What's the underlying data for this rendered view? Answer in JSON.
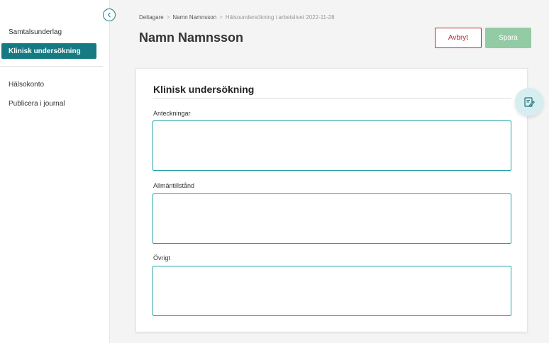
{
  "sidebar": {
    "items": [
      {
        "label": "Samtalsunderlag"
      },
      {
        "label": "Klinisk undersökning"
      },
      {
        "label": "Hälsokonto"
      },
      {
        "label": "Publicera i journal"
      }
    ],
    "active_index": 1
  },
  "breadcrumb": {
    "items": [
      "Deltagare",
      "Namn Namnsson",
      "Hälsoundersökning i arbetslivet 2022-11-28"
    ]
  },
  "header": {
    "title": "Namn Namnsson",
    "cancel_label": "Avbryt",
    "save_label": "Spara"
  },
  "card": {
    "title": "Klinisk undersökning",
    "fields": [
      {
        "label": "Anteckningar",
        "value": ""
      },
      {
        "label": "Allmäntillstånd",
        "value": ""
      },
      {
        "label": "Övrigt",
        "value": ""
      }
    ]
  },
  "icons": {
    "collapse": "chevron-left-icon",
    "float": "edit-note-icon"
  },
  "colors": {
    "accent": "#157a82",
    "danger": "#c0252f",
    "save": "#93cca4",
    "field_border": "#1fa3a8"
  }
}
